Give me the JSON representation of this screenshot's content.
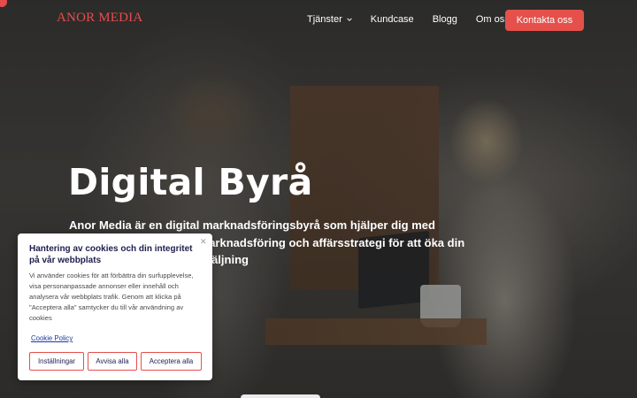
{
  "brand": {
    "name": "ANOR MEDIA",
    "accent": "#e5504b"
  },
  "nav": {
    "items": [
      {
        "label": "Tjänster",
        "has_dropdown": true
      },
      {
        "label": "Kundcase"
      },
      {
        "label": "Blogg"
      },
      {
        "label": "Om oss"
      }
    ],
    "cta_label": "Kontakta oss"
  },
  "hero": {
    "title": "Digital Byrå",
    "description": "Anor Media är en digital marknadsföringsbyrå som hjälper dig med webbutveckling, digital marknadsföring och affärsstrategi för att öka din digitala synlighet och försäljning"
  },
  "cookie_banner": {
    "title": "Hantering av cookies och din integritet på vår webbplats",
    "body": "Vi använder cookies för att förbättra din surfupplevelse, visa personanpassade annonser eller innehåll och analysera vår webbplats trafik. Genom att klicka på \"Acceptera alla\" samtycker du till vår användning av cookies",
    "policy_link": "Cookie Policy",
    "close_icon": "close-icon",
    "buttons": {
      "settings": "Inställningar",
      "deny": "Avvisa alla",
      "accept": "Acceptera alla"
    }
  }
}
